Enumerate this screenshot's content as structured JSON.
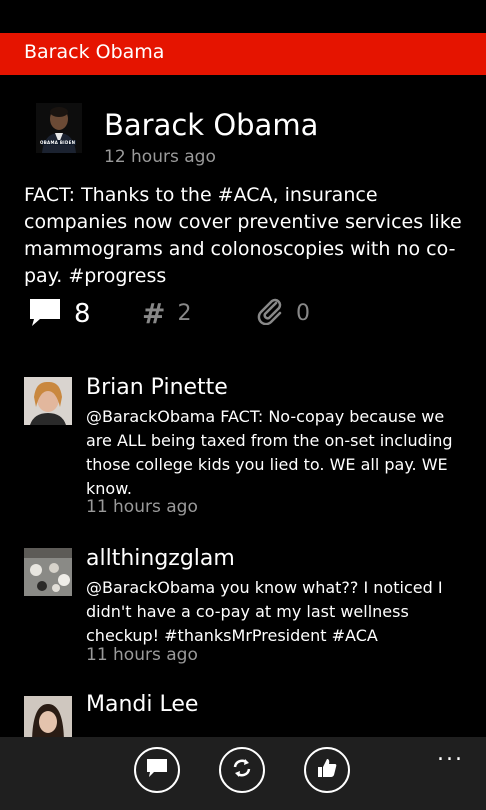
{
  "header": {
    "title": "Barack Obama"
  },
  "tweet": {
    "author": "Barack Obama",
    "time": "12 hours ago",
    "text": "FACT: Thanks to the #ACA, insurance companies now cover preventive services like mammograms and colonoscopies with no co-pay. #progress",
    "avatar_label": "OBAMA BIDEN"
  },
  "stats": {
    "replies": "8",
    "hashtags": "2",
    "attachments": "0"
  },
  "replies": [
    {
      "name": "Brian Pinette",
      "text": "@BarackObama FACT: No-copay because we are ALL being taxed from the on-set including those college kids you lied to. WE all pay. WE know.",
      "time": "11 hours ago"
    },
    {
      "name": "allthingzglam",
      "text": "@BarackObama you know what?? I noticed I didn't have a co-pay at my last wellness checkup! #thanksMrPresident #ACA",
      "time": "11 hours ago"
    },
    {
      "name": "Mandi Lee",
      "text": "",
      "time": ""
    }
  ],
  "appbar": {
    "icons": [
      "reply-icon",
      "retweet-icon",
      "like-icon"
    ],
    "more": "..."
  }
}
